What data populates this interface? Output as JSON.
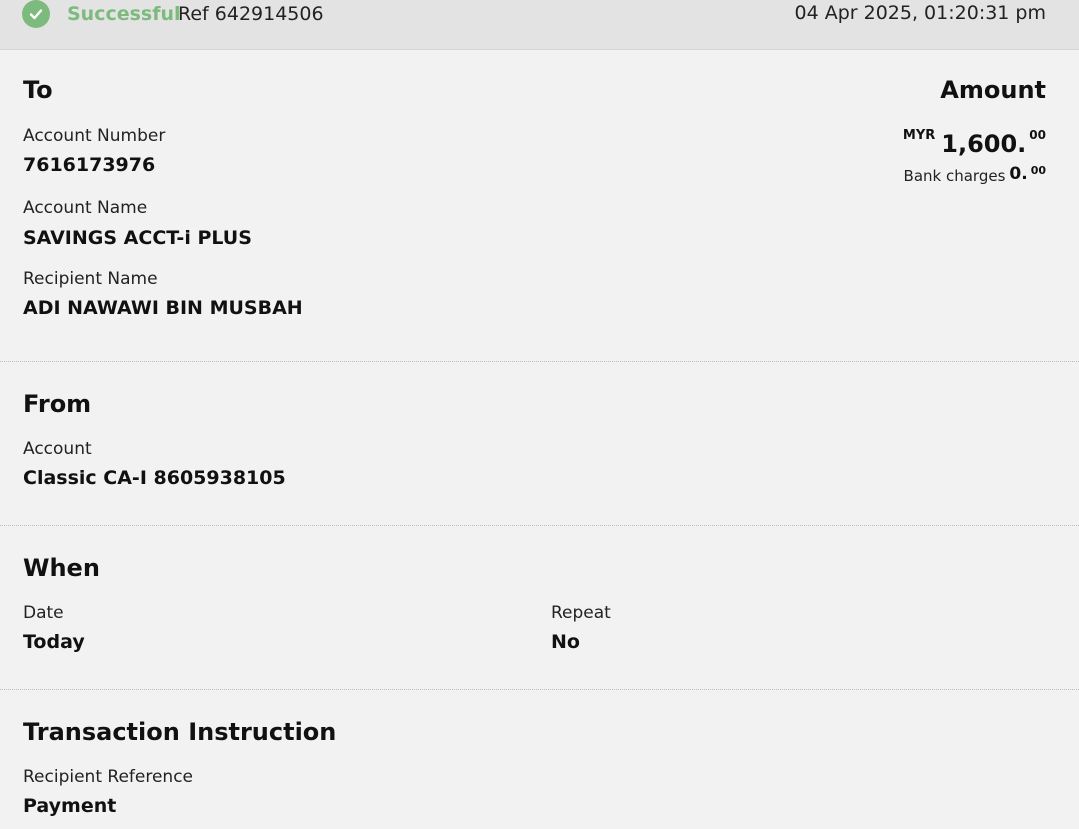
{
  "status": {
    "label": "Successful",
    "ref": "Ref 642914506",
    "timestamp": "04 Apr 2025, 01:20:31 pm",
    "icon": "check-circle-icon",
    "color": "#7dba7d"
  },
  "to": {
    "heading": "To",
    "account_number_label": "Account Number",
    "account_number": "7616173976",
    "account_name_label": "Account Name",
    "account_name": "SAVINGS ACCT-i PLUS",
    "recipient_name_label": "Recipient Name",
    "recipient_name": "ADI NAWAWI BIN MUSBAH"
  },
  "amount": {
    "heading": "Amount",
    "currency": "MYR",
    "value_main": "1,600.",
    "value_decimal": "00",
    "bank_charges_label": "Bank charges",
    "bank_charges_main": "0.",
    "bank_charges_decimal": "00"
  },
  "from": {
    "heading": "From",
    "account_label": "Account",
    "account": "Classic CA-I 8605938105"
  },
  "when": {
    "heading": "When",
    "date_label": "Date",
    "date": "Today",
    "repeat_label": "Repeat",
    "repeat": "No"
  },
  "instruction": {
    "heading": "Transaction Instruction",
    "recipient_reference_label": "Recipient Reference",
    "recipient_reference": "Payment"
  }
}
